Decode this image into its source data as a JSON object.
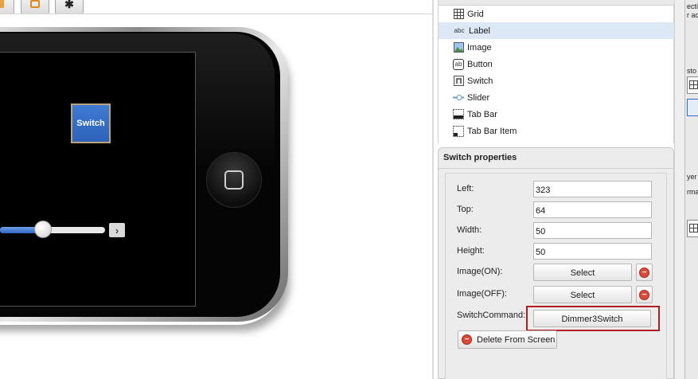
{
  "toolbar": {
    "buttons": [
      {
        "icon": "partial-toolbar-icon"
      },
      {
        "icon": "orange-toolbar-icon"
      },
      {
        "icon": "up-arrow-icon"
      }
    ]
  },
  "phone": {
    "switch_label": "Switch",
    "slider_value_fraction": 0.33,
    "slider_max_icon": "chevron-right-icon",
    "accent": "#2d62b8"
  },
  "palette": {
    "items": [
      {
        "label": "Grid",
        "icon": "grid-icon",
        "selected": false
      },
      {
        "label": "Label",
        "icon_text": "abc",
        "icon": "label-icon",
        "selected": true
      },
      {
        "label": "Image",
        "icon": "image-icon",
        "selected": false
      },
      {
        "label": "Button",
        "icon_text": "ab",
        "icon": "button-icon",
        "selected": false
      },
      {
        "label": "Switch",
        "icon": "switch-icon",
        "selected": false
      },
      {
        "label": "Slider",
        "icon": "slider-icon",
        "selected": false
      },
      {
        "label": "Tab Bar",
        "icon": "tab-bar-icon",
        "selected": false
      },
      {
        "label": "Tab Bar Item",
        "icon": "tab-bar-item-icon",
        "selected": false
      }
    ]
  },
  "properties": {
    "title": "Switch properties",
    "left_label": "Left:",
    "left_value": "323",
    "top_label": "Top:",
    "top_value": "64",
    "width_label": "Width:",
    "width_value": "50",
    "height_label": "Height:",
    "height_value": "50",
    "image_on_label": "Image(ON):",
    "image_off_label": "Image(OFF):",
    "select_label": "Select",
    "switch_command_label": "SwitchCommand:",
    "switch_command_value": "Dimmer3Switch",
    "delete_label": "Delete From Screen",
    "highlight_color": "#b21e1e"
  },
  "right_fragment": {
    "texts": [
      "ecti",
      "r ac",
      "sto",
      "yer",
      "rma"
    ]
  }
}
